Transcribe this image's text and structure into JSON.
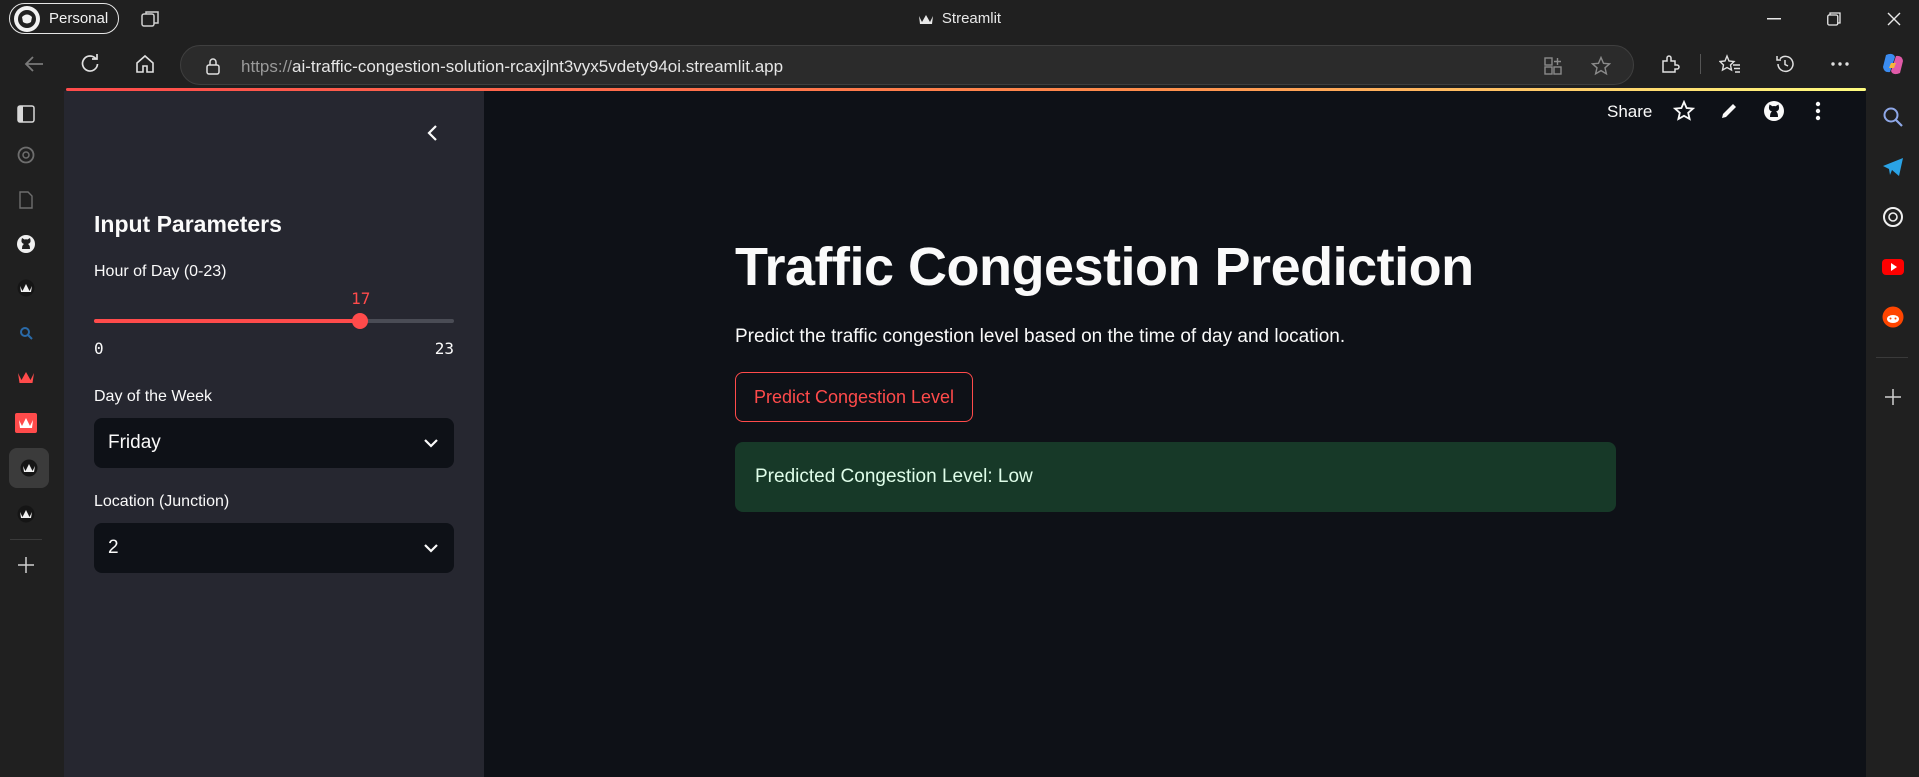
{
  "browser": {
    "profile_label": "Personal",
    "window_title": "Streamlit",
    "url_protocol": "https://",
    "url_host": "ai-traffic-congestion-solution-rcaxjlnt3vyx5vdety94oi.streamlit.app"
  },
  "app": {
    "share_label": "Share",
    "sidebar": {
      "title": "Input Parameters",
      "hour": {
        "label": "Hour of Day (0-23)",
        "value": "17",
        "min": "0",
        "max": "23"
      },
      "day": {
        "label": "Day of the Week",
        "selected": "Friday"
      },
      "location": {
        "label": "Location (Junction)",
        "selected": "2"
      }
    },
    "main": {
      "title": "Traffic Congestion Prediction",
      "description": "Predict the traffic congestion level based on the time of day and location.",
      "button_label": "Predict Congestion Level",
      "result_text": "Predicted Congestion Level: Low"
    }
  },
  "colors": {
    "accent": "#ff4b4b",
    "success_bg": "#173928",
    "app_bg": "#0e1117",
    "sidebar_bg": "#262730"
  }
}
